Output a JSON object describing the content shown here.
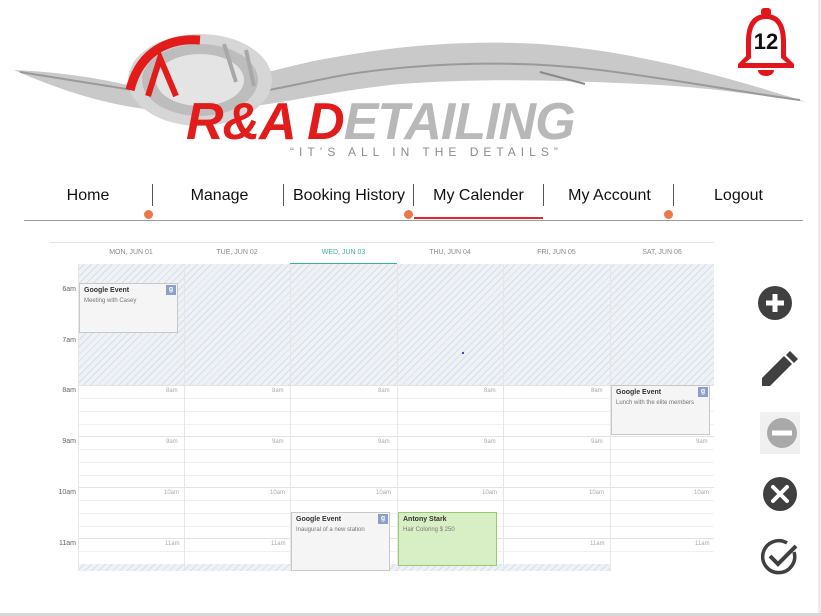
{
  "brand": {
    "name_red": "R&A D",
    "name_grey": "ETAILING",
    "tagline": "“IT’S ALL IN THE DETAILS”"
  },
  "notifications": {
    "count": "12",
    "icon": "bell-icon",
    "color": "#e3141b"
  },
  "nav": {
    "items": [
      {
        "label": "Home",
        "active": false
      },
      {
        "label": "Manage",
        "active": false
      },
      {
        "label": "Booking History",
        "active": false
      },
      {
        "label": "My Calender",
        "active": true
      },
      {
        "label": "My Account",
        "active": false
      },
      {
        "label": "Logout",
        "active": false
      }
    ],
    "accent": "#e0262f"
  },
  "calendar": {
    "days": [
      {
        "label": "MON, JUN 01",
        "today": false
      },
      {
        "label": "TUE, JUN 02",
        "today": false
      },
      {
        "label": "WED, JUN 03",
        "today": true
      },
      {
        "label": "THU, JUN 04",
        "today": false
      },
      {
        "label": "FRI, JUN 05",
        "today": false
      },
      {
        "label": "SAT, JUN 06",
        "today": false
      }
    ],
    "hours": [
      "6am",
      "7am",
      "8am",
      "9am",
      "10am",
      "11am"
    ],
    "slot_labels": [
      "8am",
      "9am",
      "10am",
      "11am"
    ],
    "events": [
      {
        "title": "Google Event",
        "subtitle": "Meeting with Casey",
        "badge": "g"
      },
      {
        "title": "Google Event",
        "subtitle": "Lunch with the elite members",
        "badge": "g"
      },
      {
        "title": "Google Event",
        "subtitle": "Inaugural of a new station",
        "badge": "g"
      },
      {
        "title": "Antony Stark",
        "subtitle": "Hair Coloring $ 250",
        "badge": ""
      }
    ],
    "today_color": "#3bb39b"
  },
  "actions": [
    {
      "name": "add-icon",
      "label": "add"
    },
    {
      "name": "edit-icon",
      "label": "edit"
    },
    {
      "name": "remove-icon",
      "label": "remove"
    },
    {
      "name": "close-icon",
      "label": "cancel"
    },
    {
      "name": "check-icon",
      "label": "confirm"
    }
  ]
}
